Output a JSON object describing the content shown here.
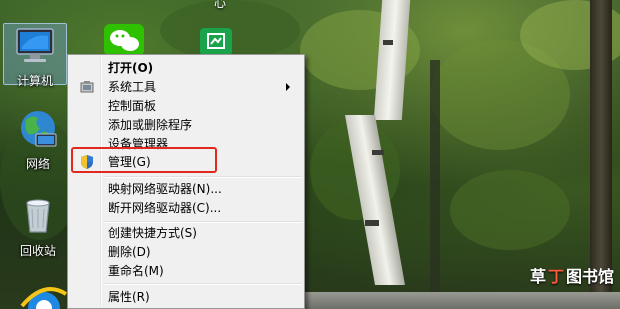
{
  "desktop": {
    "icons": [
      {
        "label": "计算机"
      },
      {
        "label": "网络"
      },
      {
        "label": "回收站"
      }
    ],
    "top_partial_text": "心"
  },
  "context_menu": {
    "items": [
      {
        "label": "打开(O)"
      },
      {
        "label": "系统工具"
      },
      {
        "label": "控制面板"
      },
      {
        "label": "添加或删除程序"
      },
      {
        "label": "设备管理器"
      },
      {
        "label": "管理(G)"
      },
      {
        "label": "映射网络驱动器(N)..."
      },
      {
        "label": "断开网络驱动器(C)..."
      },
      {
        "label": "创建快捷方式(S)"
      },
      {
        "label": "删除(D)"
      },
      {
        "label": "重命名(M)"
      },
      {
        "label": "属性(R)"
      }
    ]
  },
  "watermark": {
    "part1": "草",
    "part2": "丁",
    "part3": "图书馆"
  },
  "colors": {
    "highlight": "#e0281e",
    "menu_bg": "#f0f0f0"
  }
}
